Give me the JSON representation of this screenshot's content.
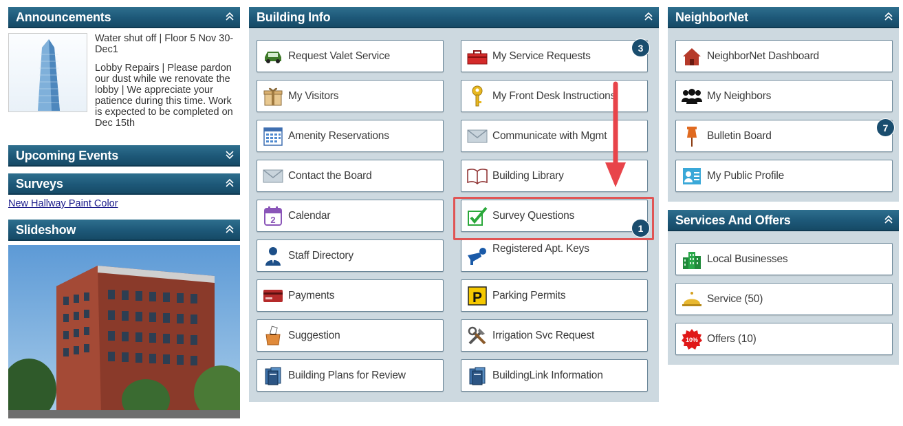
{
  "announcements": {
    "title": "Announcements",
    "items": [
      "Water shut off | Floor 5 Nov 30-Dec1",
      "Lobby Repairs | Please pardon our dust while we renovate the lobby | We appreciate your patience during this time. Work is expected to be completed on Dec 15th"
    ]
  },
  "upcoming_events": {
    "title": "Upcoming Events"
  },
  "surveys": {
    "title": "Surveys",
    "link": "New Hallway Paint Color"
  },
  "slideshow": {
    "title": "Slideshow"
  },
  "building_info": {
    "title": "Building Info",
    "left": [
      {
        "label": "Request Valet Service",
        "icon": "car-icon"
      },
      {
        "label": "My Visitors",
        "icon": "gift-box-icon"
      },
      {
        "label": "Amenity Reservations",
        "icon": "calendar-grid-icon"
      },
      {
        "label": "Contact the Board",
        "icon": "envelope-icon"
      },
      {
        "label": "Calendar",
        "icon": "calendar-icon"
      },
      {
        "label": "Staff Directory",
        "icon": "person-icon"
      },
      {
        "label": "Payments",
        "icon": "credit-card-icon"
      },
      {
        "label": "Suggestion",
        "icon": "suggestion-box-icon"
      },
      {
        "label": "Building Plans for Review",
        "icon": "books-icon"
      }
    ],
    "right": [
      {
        "label": "My Service Requests",
        "icon": "toolbox-icon",
        "badge": "3"
      },
      {
        "label": "My Front Desk Instructions",
        "icon": "key-icon"
      },
      {
        "label": "Communicate with Mgmt",
        "icon": "envelope-icon"
      },
      {
        "label": "Building Library",
        "icon": "book-icon"
      },
      {
        "label": "Survey Questions",
        "icon": "checkmark-icon",
        "badge": "1"
      },
      {
        "label": "Registered Apt. Keys",
        "icon": "keys-icon"
      },
      {
        "label": "Parking Permits",
        "icon": "parking-icon"
      },
      {
        "label": "Irrigation Svc Request",
        "icon": "tools-icon"
      },
      {
        "label": "BuildingLink Information",
        "icon": "books-icon"
      }
    ]
  },
  "neighbornet": {
    "title": "NeighborNet",
    "items": [
      {
        "label": "NeighborNet Dashboard",
        "icon": "house-icon"
      },
      {
        "label": "My Neighbors",
        "icon": "people-icon"
      },
      {
        "label": "Bulletin Board",
        "icon": "pushpin-icon",
        "badge": "7"
      },
      {
        "label": "My Public Profile",
        "icon": "profile-card-icon"
      }
    ]
  },
  "services": {
    "title": "Services And Offers",
    "items": [
      {
        "label": "Local Businesses",
        "icon": "buildings-icon"
      },
      {
        "label": "Service (50)",
        "icon": "service-bell-icon"
      },
      {
        "label": "Offers (10)",
        "icon": "offer-badge-icon",
        "badge_text": "10%"
      }
    ]
  },
  "colors": {
    "header": "#1d5878",
    "panel_bg": "#cdd9e0",
    "badge": "#1a4d6e",
    "highlight": "#e05555",
    "arrow": "#e8444a"
  }
}
